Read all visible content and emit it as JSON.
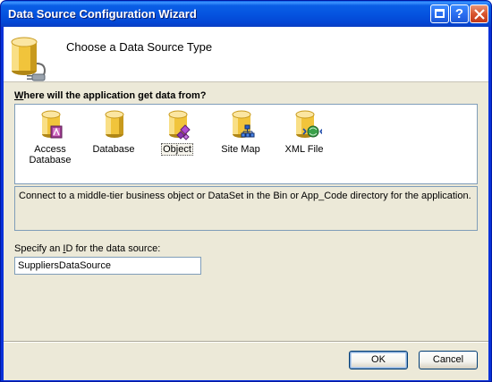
{
  "window": {
    "title": "Data Source Configuration Wizard",
    "help_glyph": "?"
  },
  "header": {
    "title": "Choose a Data Source Type"
  },
  "question": {
    "first_letter": "W",
    "rest": "here will the application get data from?"
  },
  "data_source_types": [
    {
      "label_line1": "Access",
      "label_line2": "Database",
      "icon": "access-database-icon"
    },
    {
      "label_line1": "Database",
      "label_line2": "",
      "icon": "database-icon"
    },
    {
      "label_line1": "Object",
      "label_line2": "",
      "icon": "object-icon",
      "selected": true
    },
    {
      "label_line1": "Site Map",
      "label_line2": "",
      "icon": "site-map-icon"
    },
    {
      "label_line1": "XML File",
      "label_line2": "",
      "icon": "xml-file-icon"
    }
  ],
  "description": "Connect to a middle-tier business object or DataSet in the Bin or App_Code directory for the application.",
  "id_field": {
    "label_before": "Specify an ",
    "label_underlined": "I",
    "label_after": "D for the data source:",
    "value": "SuppliersDataSource"
  },
  "buttons": {
    "ok": "OK",
    "cancel": "Cancel"
  },
  "colors": {
    "titlebar": "#0554e0",
    "dialog_bg": "#ece9d8",
    "cylinder": "#f1c43b"
  }
}
